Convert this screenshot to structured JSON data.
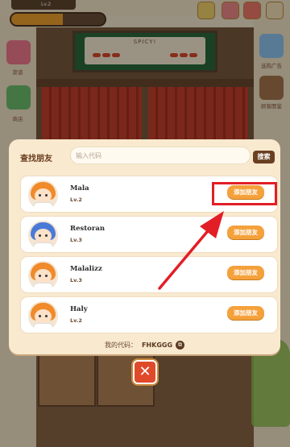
{
  "game": {
    "level_badge": "Lv.2",
    "sign_text": "SPICY!",
    "left_menu": [
      {
        "label": "菜谱",
        "icon": "recipe-book-icon"
      },
      {
        "label": "商店",
        "icon": "cart-icon"
      }
    ],
    "right_menu": [
      {
        "label": "选购广告",
        "icon": "rainbow-icon"
      },
      {
        "label": "顾客图鉴",
        "icon": "customer-book-icon"
      }
    ]
  },
  "dialog": {
    "search_label": "查找朋友",
    "search_placeholder": "输入代码",
    "search_button": "搜索",
    "friends": [
      {
        "name": "Mala",
        "level": "Lv.2",
        "add_label": "添加朋友",
        "hair_color": "#f08a2a"
      },
      {
        "name": "Restoran",
        "level": "Lv.3",
        "add_label": "添加朋友",
        "hair_color": "#4a7ad8"
      },
      {
        "name": "Malalizz",
        "level": "Lv.3",
        "add_label": "添加朋友",
        "hair_color": "#f08a2a"
      },
      {
        "name": "Haly",
        "level": "Lv.2",
        "add_label": "添加朋友",
        "hair_color": "#f08a2a"
      }
    ],
    "my_code_label": "我的代码：",
    "my_code": "FHKGGG",
    "close_label": "✕"
  },
  "colors": {
    "accent": "#f5a13b",
    "highlight": "#e21e26",
    "dark_brown": "#6a3f22"
  }
}
